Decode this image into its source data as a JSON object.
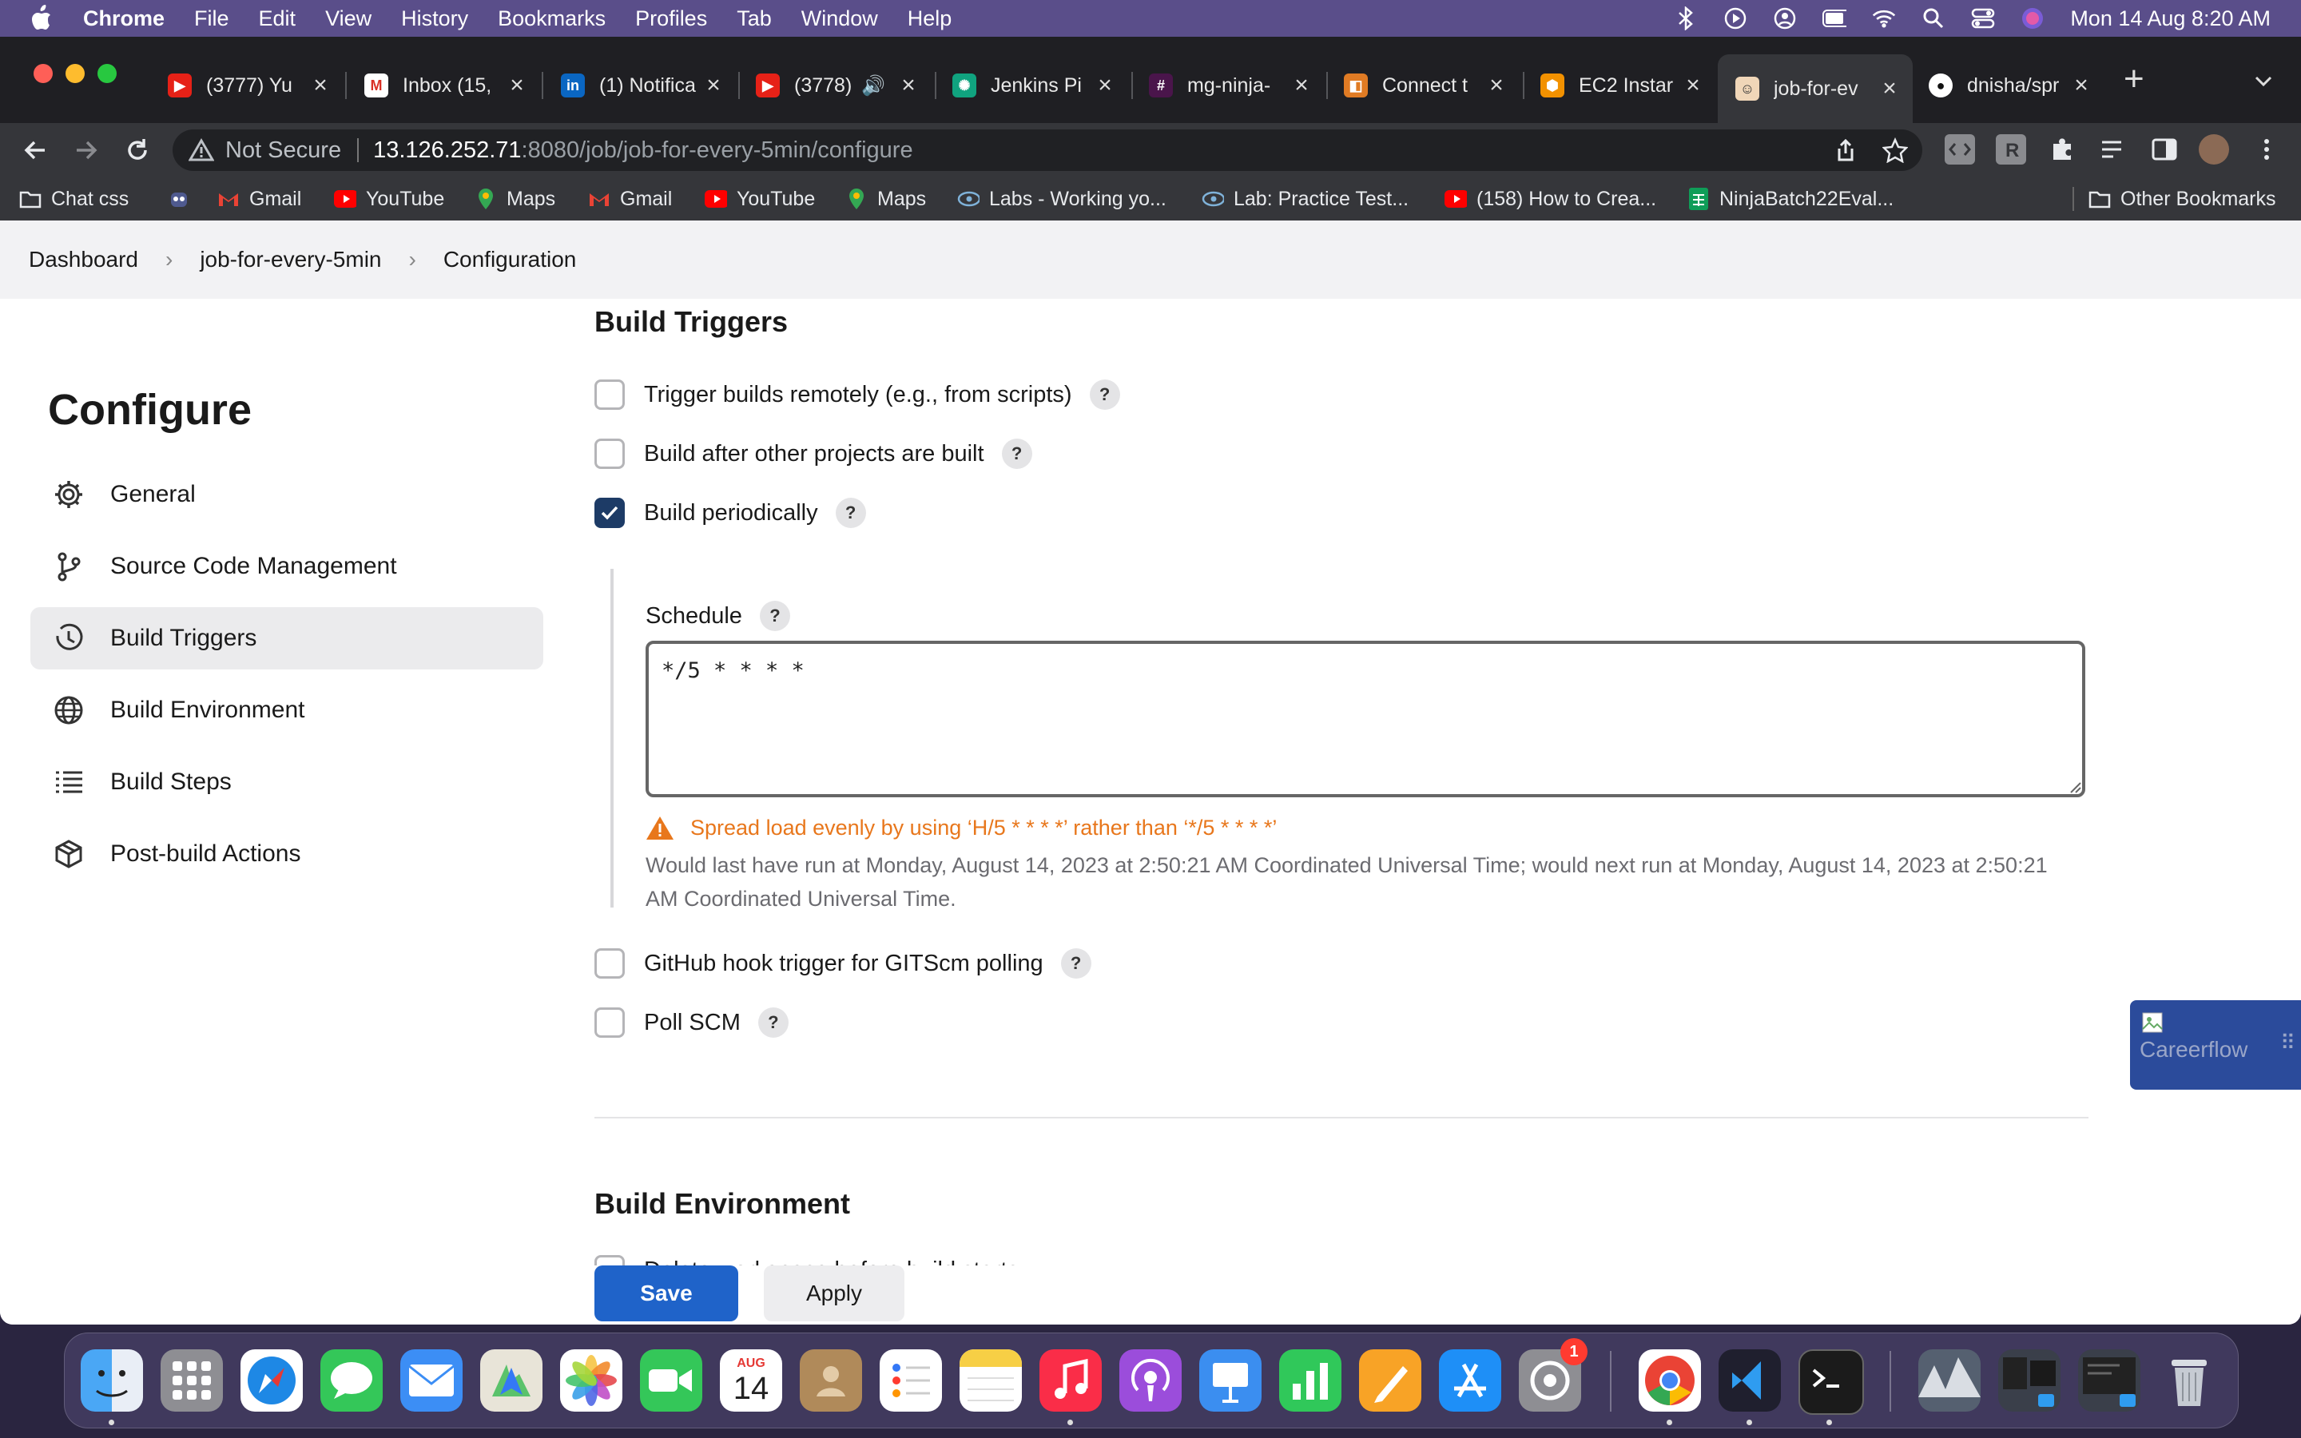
{
  "menubar": {
    "app": "Chrome",
    "items": [
      "File",
      "Edit",
      "View",
      "History",
      "Bookmarks",
      "Profiles",
      "Tab",
      "Window",
      "Help"
    ],
    "clock": "Mon 14 Aug  8:20 AM"
  },
  "tabs": [
    {
      "title": "(3777) Yu",
      "icon": "youtube-icon",
      "color": "#e62117"
    },
    {
      "title": "Inbox (15,",
      "icon": "gmail-icon",
      "color": "#ffffff"
    },
    {
      "title": "(1) Notifica",
      "icon": "linkedin-icon",
      "color": "#0a66c2"
    },
    {
      "title": "(3778)",
      "icon": "youtube-icon",
      "color": "#e62117"
    },
    {
      "title": "Jenkins Pi",
      "icon": "chatgpt-icon",
      "color": "#10a37f"
    },
    {
      "title": "mg-ninja-",
      "icon": "slack-icon",
      "color": "#4a154b"
    },
    {
      "title": "Connect t",
      "icon": "aws-console-icon",
      "color": "#e07b24"
    },
    {
      "title": "EC2 Instar",
      "icon": "aws-ec2-icon",
      "color": "#f29100"
    },
    {
      "title": "job-for-ev",
      "icon": "jenkins-icon",
      "color": "#d33833"
    },
    {
      "title": "dnisha/spr",
      "icon": "github-icon",
      "color": "#ffffff"
    }
  ],
  "address": {
    "security": "Not Secure",
    "host": "13.126.252.71",
    "path": ":8080/job/job-for-every-5min/configure"
  },
  "bookmarks": [
    {
      "label": "Chat css",
      "icon": "folder-icon"
    },
    {
      "label": "",
      "icon": "bot-icon"
    },
    {
      "label": "Gmail",
      "icon": "gmail-icon"
    },
    {
      "label": "YouTube",
      "icon": "youtube-icon"
    },
    {
      "label": "Maps",
      "icon": "maps-icon"
    },
    {
      "label": "Gmail",
      "icon": "gmail-icon"
    },
    {
      "label": "YouTube",
      "icon": "youtube-icon"
    },
    {
      "label": "Maps",
      "icon": "maps-icon"
    },
    {
      "label": "Labs - Working yo...",
      "icon": "eye-icon"
    },
    {
      "label": "Lab: Practice Test...",
      "icon": "eye-icon"
    },
    {
      "label": "(158) How to Crea...",
      "icon": "youtube-icon"
    },
    {
      "label": "NinjaBatch22Eval...",
      "icon": "sheets-icon"
    }
  ],
  "other_bookmarks": "Other Bookmarks",
  "breadcrumb": [
    "Dashboard",
    "job-for-every-5min",
    "Configuration"
  ],
  "sidebar": {
    "title": "Configure",
    "items": [
      {
        "label": "General",
        "icon": "gear-icon"
      },
      {
        "label": "Source Code Management",
        "icon": "git-branch-icon"
      },
      {
        "label": "Build Triggers",
        "icon": "clock-icon"
      },
      {
        "label": "Build Environment",
        "icon": "globe-icon"
      },
      {
        "label": "Build Steps",
        "icon": "list-icon"
      },
      {
        "label": "Post-build Actions",
        "icon": "package-icon"
      }
    ],
    "selected": "Build Triggers"
  },
  "build_triggers": {
    "heading": "Build Triggers",
    "options": [
      {
        "label": "Trigger builds remotely (e.g., from scripts)",
        "checked": false
      },
      {
        "label": "Build after other projects are built",
        "checked": false
      },
      {
        "label": "Build periodically",
        "checked": true
      },
      {
        "label": "GitHub hook trigger for GITScm polling",
        "checked": false
      },
      {
        "label": "Poll SCM",
        "checked": false
      }
    ],
    "schedule_label": "Schedule",
    "schedule_value": "*/5 * * * *",
    "warning": "Spread load evenly by using ‘H/5 * * * *’ rather than ‘*/5 * * * *’",
    "info": "Would last have run at Monday, August 14, 2023 at 2:50:21 AM Coordinated Universal Time; would next run at Monday, August 14, 2023 at 2:50:21 AM Coordinated Universal Time."
  },
  "build_environment": {
    "heading": "Build Environment",
    "options": [
      {
        "label": "Delete workspace before build starts",
        "checked": false
      }
    ]
  },
  "buttons": {
    "save": "Save",
    "apply": "Apply"
  },
  "careerflow": "Careerflow",
  "dock": {
    "calendar_month": "AUG",
    "calendar_day": "14",
    "settings_badge": "1"
  }
}
